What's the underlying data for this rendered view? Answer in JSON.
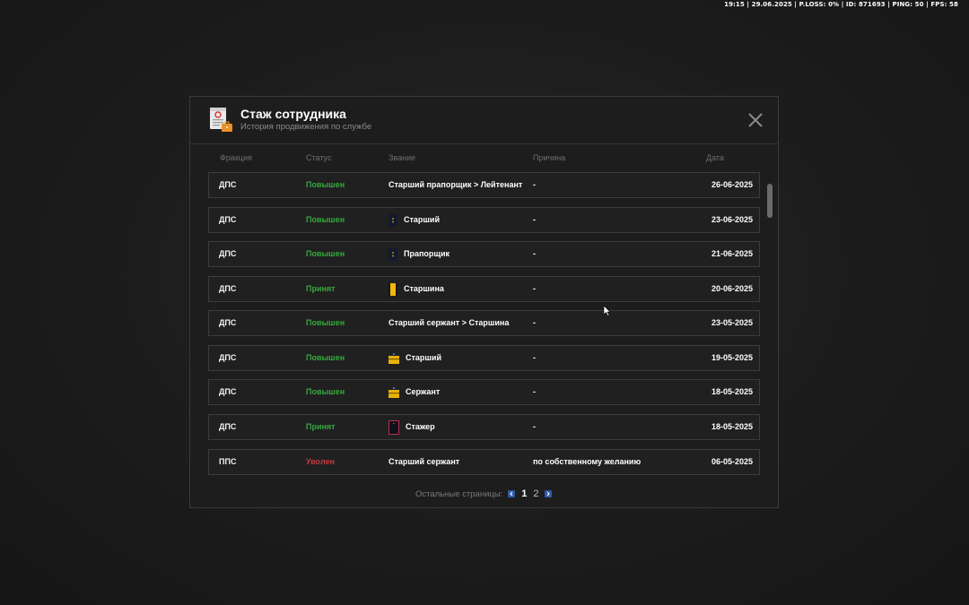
{
  "hud": {
    "text": "19:15 | 29.06.2025 | P.LOSS: 0% | ID: 871693 | PING: 50 | FPS: 58"
  },
  "modal": {
    "title": "Стаж сотрудника",
    "subtitle": "История продвижения по службе",
    "icon": "document-briefcase-icon",
    "close_icon": "close-icon"
  },
  "columns": {
    "faction": "Фракция",
    "status": "Статус",
    "rank": "Звание",
    "reason": "Причина",
    "date": "Дата"
  },
  "rows": [
    {
      "faction": "ДПС",
      "status": "Повышен",
      "status_kind": "promo",
      "rank": "Старший прапорщик > Лейтенант",
      "rank_icon": "",
      "reason": "-",
      "date": "26-06-2025"
    },
    {
      "faction": "ДПС",
      "status": "Повышен",
      "status_kind": "promo",
      "rank": "Старший",
      "rank_icon": "navy-strap",
      "reason": "-",
      "date": "23-06-2025"
    },
    {
      "faction": "ДПС",
      "status": "Повышен",
      "status_kind": "promo",
      "rank": "Прапорщик",
      "rank_icon": "navy-strap",
      "reason": "-",
      "date": "21-06-2025"
    },
    {
      "faction": "ДПС",
      "status": "Принят",
      "status_kind": "hired",
      "rank": "Старшина",
      "rank_icon": "yellow-strap",
      "reason": "-",
      "date": "20-06-2025"
    },
    {
      "faction": "ДПС",
      "status": "Повышен",
      "status_kind": "promo",
      "rank": "Старший сержант > Старшина",
      "rank_icon": "",
      "reason": "-",
      "date": "23-05-2025"
    },
    {
      "faction": "ДПС",
      "status": "Повышен",
      "status_kind": "promo",
      "rank": "Старший",
      "rank_icon": "yellow-bar",
      "reason": "-",
      "date": "19-05-2025"
    },
    {
      "faction": "ДПС",
      "status": "Повышен",
      "status_kind": "promo",
      "rank": "Сержант",
      "rank_icon": "yellow-bar",
      "reason": "-",
      "date": "18-05-2025"
    },
    {
      "faction": "ДПС",
      "status": "Принят",
      "status_kind": "hired",
      "rank": "Стажер",
      "rank_icon": "red-outline-strap",
      "reason": "-",
      "date": "18-05-2025"
    },
    {
      "faction": "ППС",
      "status": "Уволен",
      "status_kind": "fired",
      "rank": "Старший сержант",
      "rank_icon": "",
      "reason": "по собственному желанию",
      "date": "06-05-2025"
    }
  ],
  "pager": {
    "label": "Остальные страницы:",
    "pages": [
      "1",
      "2"
    ],
    "current": "1",
    "prev_icon": "chevron-left-icon",
    "next_icon": "chevron-right-icon"
  },
  "colors": {
    "promo": "#36a83e",
    "fired": "#c23a3a",
    "pager_arrow": "#2f5aa8"
  }
}
